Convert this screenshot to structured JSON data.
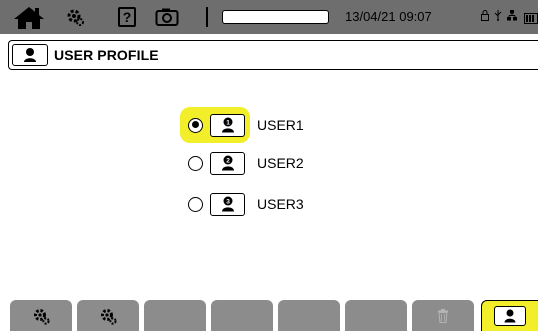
{
  "status_bar": {
    "icons": [
      "home-icon",
      "settings-icon",
      "help-icon",
      "camera-icon"
    ],
    "help_glyph": "?",
    "recording_progress": 0.0,
    "datetime": "13/04/21 09:07",
    "status_icons": [
      "lock-icon",
      "usb-icon",
      "network-icon",
      "battery-icon"
    ]
  },
  "title_bar": {
    "icon": "user-icon",
    "title": "USER PROFILE"
  },
  "users": [
    {
      "label": "USER1",
      "selected": true,
      "icon": "user-icon"
    },
    {
      "label": "USER2",
      "selected": false,
      "icon": "user-icon"
    },
    {
      "label": "USER3",
      "selected": false,
      "icon": "user-icon"
    }
  ],
  "bottom_tabs": [
    {
      "icon": "settings-icon",
      "active": false
    },
    {
      "icon": "settings-icon",
      "active": false
    },
    {
      "icon": "",
      "active": false
    },
    {
      "icon": "",
      "active": false
    },
    {
      "icon": "",
      "active": false
    },
    {
      "icon": "",
      "active": false
    },
    {
      "icon": "trash-icon",
      "active": false
    },
    {
      "icon": "user-icon",
      "active": true
    }
  ],
  "colors": {
    "status_bar_bg": "#6e6e6e",
    "highlight": "#f3ee2a",
    "tab_bg": "#8c8c8c"
  }
}
